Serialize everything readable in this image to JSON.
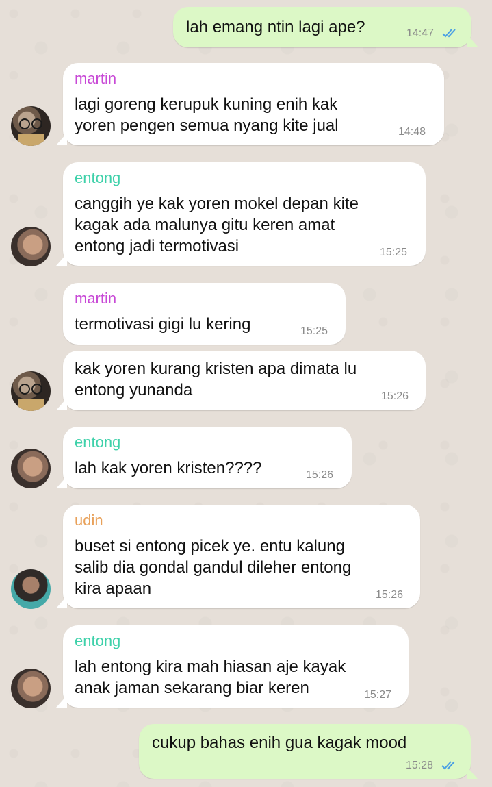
{
  "colors": {
    "martin": "#c849d6",
    "entong": "#3fd1aa",
    "udin": "#e8a15a",
    "read_ticks": "#4a9fe4"
  },
  "messages": [
    {
      "text": "lah emang ntin lagi ape?",
      "time": "14:47"
    },
    {
      "sender": "martin",
      "text": "lagi goreng kerupuk kuning enih kak\nyoren pengen semua nyang kite jual",
      "time": "14:48"
    },
    {
      "sender": "entong",
      "text": "canggih ye kak yoren mokel depan kite\nkagak ada malunya gitu keren amat\nentong jadi termotivasi",
      "time": "15:25"
    },
    {
      "sender": "martin",
      "text": "termotivasi gigi lu kering",
      "time": "15:25"
    },
    {
      "text": "kak yoren kurang kristen apa dimata lu\nentong yunanda",
      "time": "15:26"
    },
    {
      "sender": "entong",
      "text": "lah kak yoren kristen????",
      "time": "15:26"
    },
    {
      "sender": "udin",
      "text": "buset si entong picek ye. entu kalung\nsalib dia gondal gandul dileher entong\nkira apaan",
      "time": "15:26"
    },
    {
      "sender": "entong",
      "text": "lah entong kira mah hiasan aje kayak\nanak jaman sekarang biar keren",
      "time": "15:27"
    },
    {
      "text": "cukup bahas enih gua kagak mood",
      "time": "15:28"
    }
  ]
}
